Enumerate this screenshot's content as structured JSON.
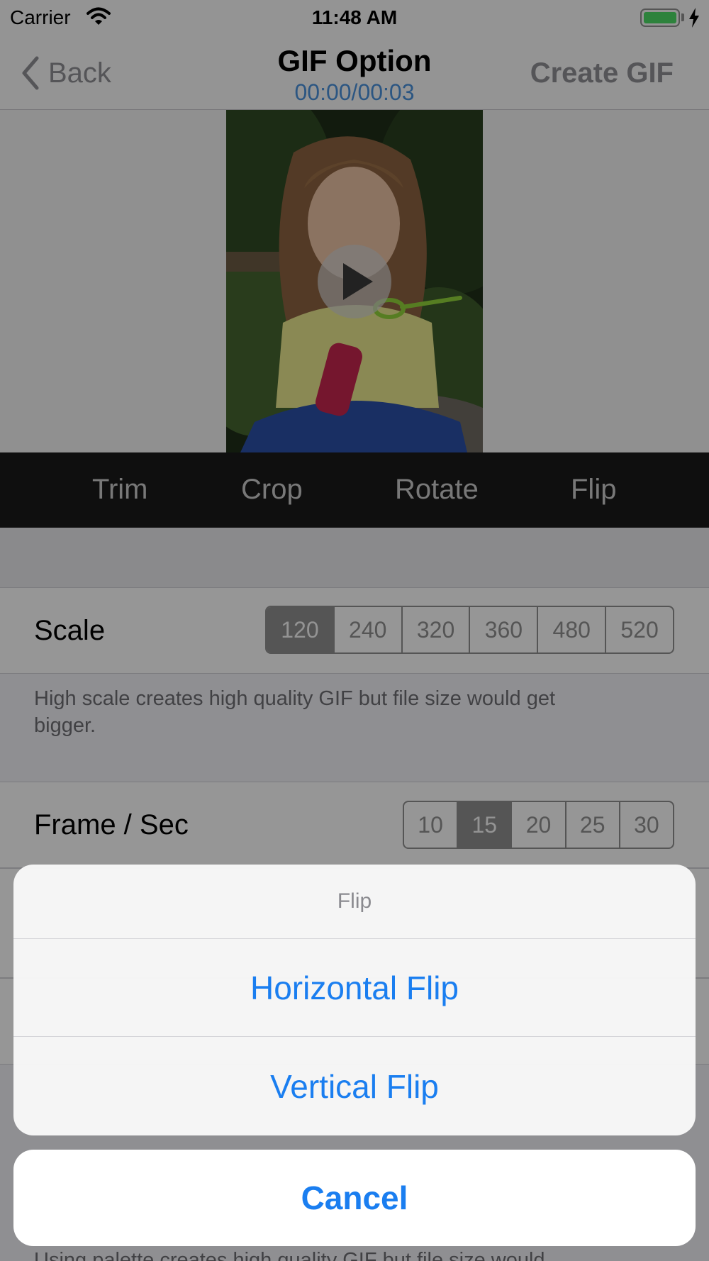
{
  "status_bar": {
    "carrier": "Carrier",
    "time": "11:48 AM"
  },
  "nav": {
    "back_label": "Back",
    "title": "GIF Option",
    "subtitle": "00:00/00:03",
    "create_label": "Create GIF"
  },
  "toolbar": {
    "items": [
      "Trim",
      "Crop",
      "Rotate",
      "Flip"
    ]
  },
  "scale": {
    "label": "Scale",
    "options": [
      "120",
      "240",
      "320",
      "360",
      "480",
      "520"
    ],
    "selected": "120",
    "note": "High scale creates high quality GIF but file size would get bigger."
  },
  "fps": {
    "label": "Frame / Sec",
    "options": [
      "10",
      "15",
      "20",
      "25",
      "30"
    ],
    "selected": "15"
  },
  "partial_note": "Using palette creates high quality GIF but file size would",
  "action_sheet": {
    "title": "Flip",
    "actions": [
      "Horizontal Flip",
      "Vertical Flip"
    ],
    "cancel": "Cancel"
  },
  "colors": {
    "accent": "#1a7ef0",
    "timecode": "#4a90d9",
    "battery": "#4cd964"
  }
}
